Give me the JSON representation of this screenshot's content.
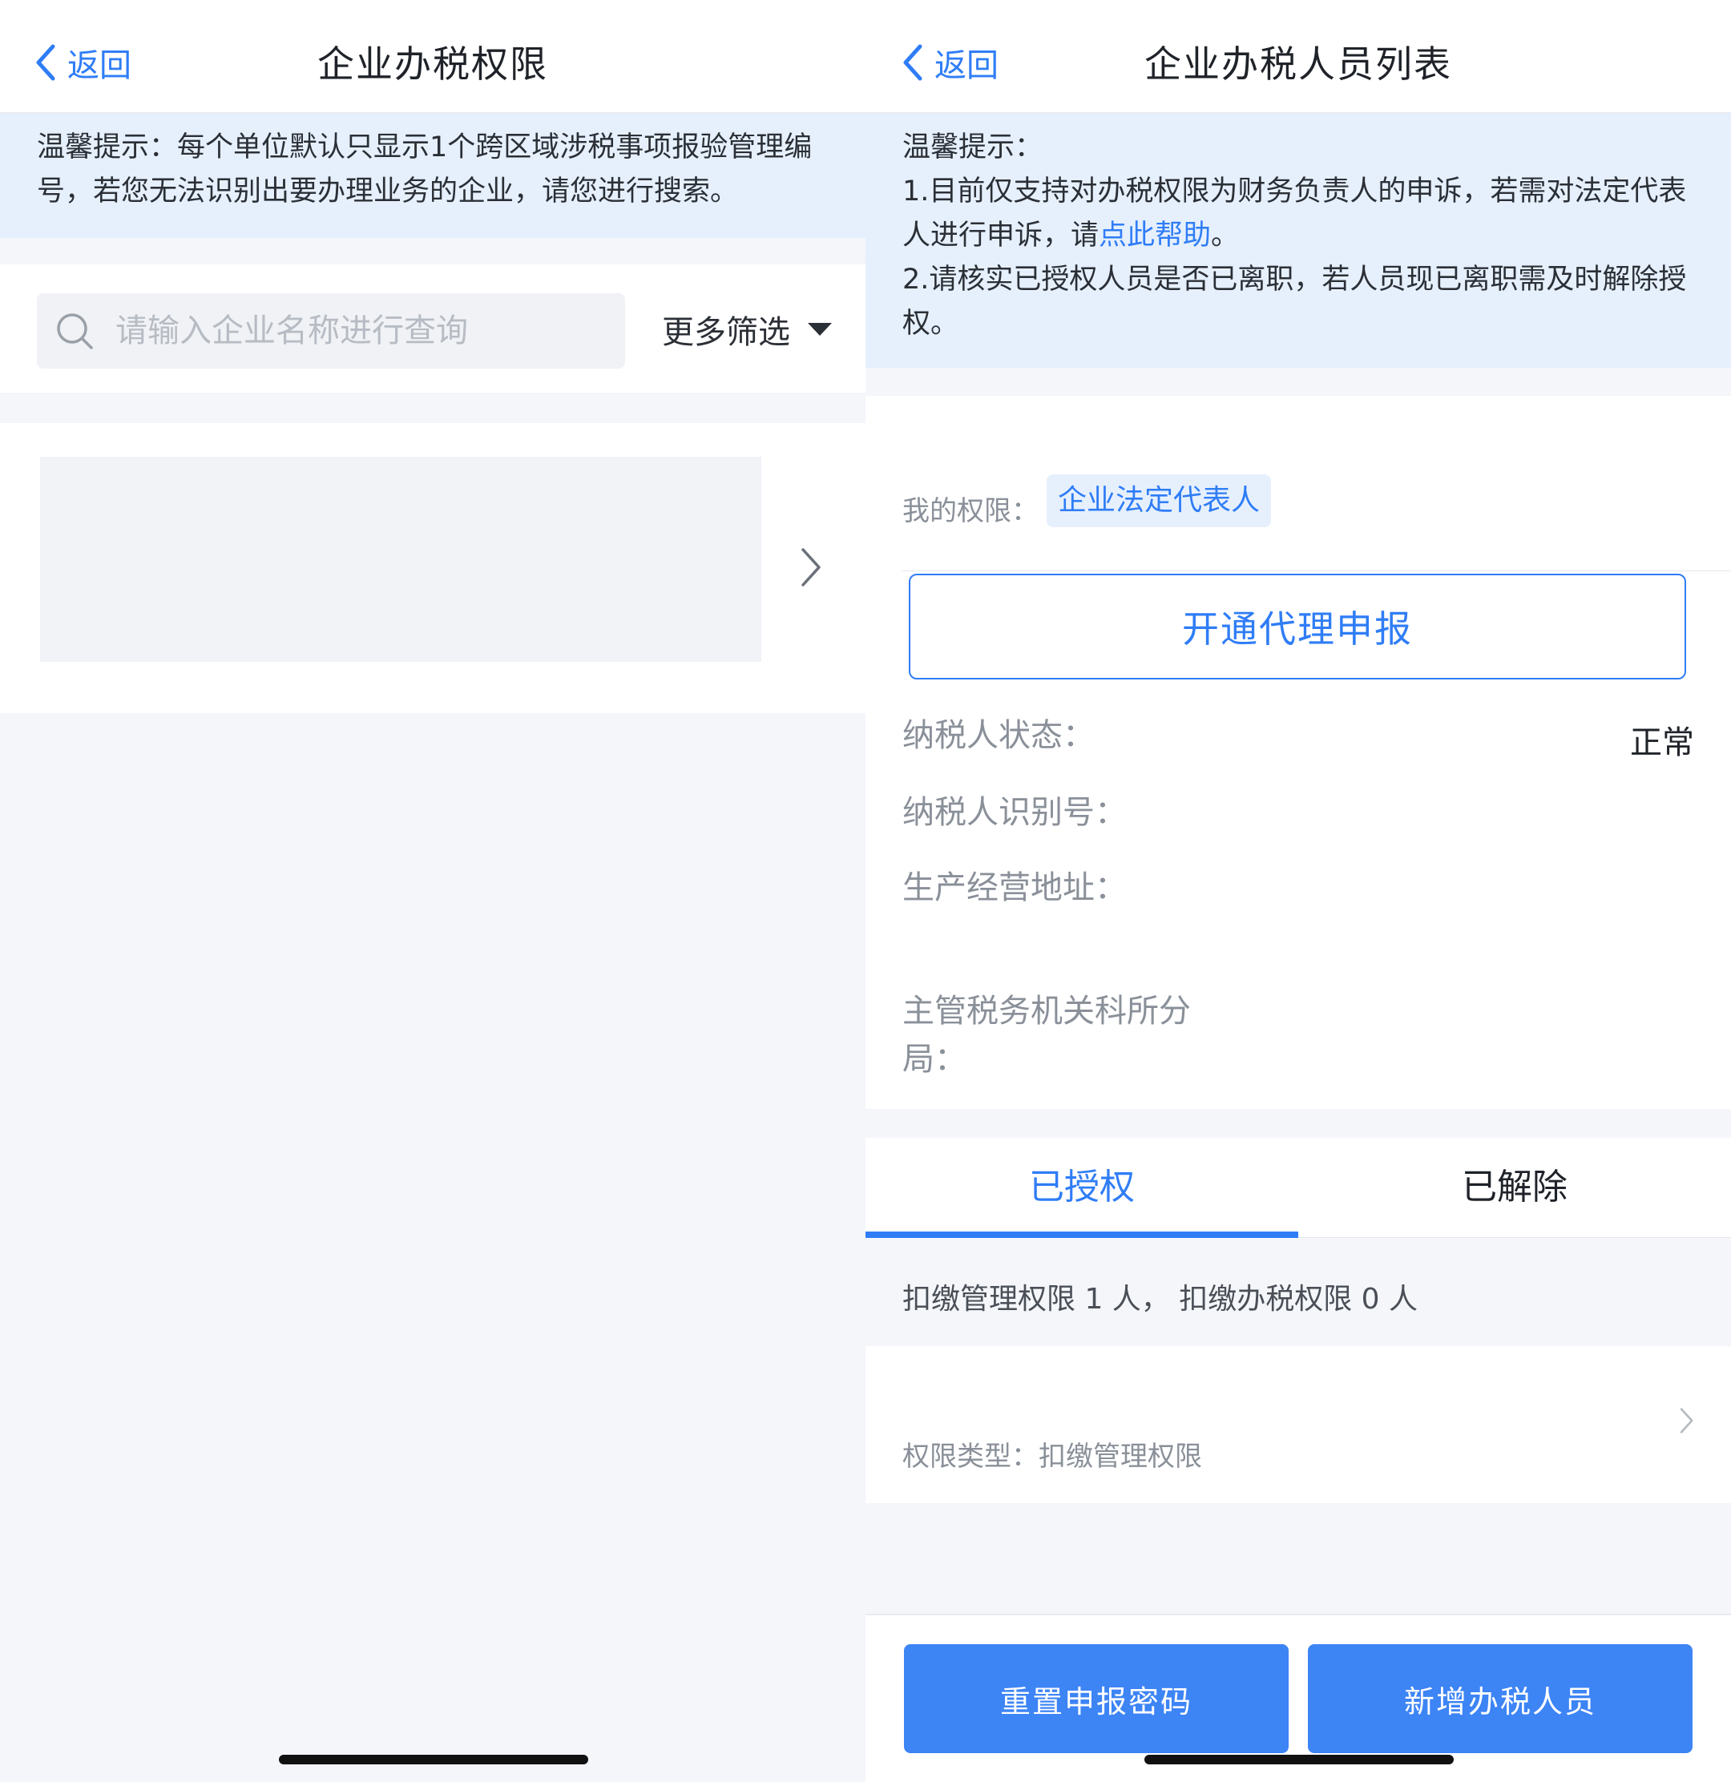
{
  "left": {
    "header": {
      "back_label": "返回",
      "title": "企业办税权限"
    },
    "tip": "温馨提示：每个单位默认只显示1个跨区域涉税事项报验管理编号，若您无法识别出要办理业务的企业，请您进行搜索。",
    "search": {
      "placeholder": "请输入企业名称进行查询",
      "filter_label": "更多筛选"
    }
  },
  "right": {
    "header": {
      "back_label": "返回",
      "title": "企业办税人员列表"
    },
    "tip": {
      "heading": "温馨提示：",
      "line1_prefix": "1.目前仅支持对办税权限为财务负责人的申诉，若需对法定代表人进行申诉，请",
      "line1_link": "点此帮助",
      "line1_suffix": "。",
      "line2": "2.请核实已授权人员是否已离职，若人员现已离职需及时解除授权。"
    },
    "info": {
      "permission_label": "我的权限：",
      "permission_tag": "企业法定代表人",
      "open_agent_button": "开通代理申报",
      "taxpayer_status_label": "纳税人状态：",
      "taxpayer_status_value": "正常",
      "taxpayer_id_label": "纳税人识别号：",
      "address_label": "生产经营地址：",
      "tax_office_label": "主管税务机关科所分局："
    },
    "tabs": [
      {
        "label": "已授权",
        "active": true
      },
      {
        "label": "已解除",
        "active": false
      }
    ],
    "count_text": "扣缴管理权限 1 人， 扣缴办税权限 0 人",
    "person": {
      "type_text": "权限类型：扣缴管理权限"
    },
    "buttons": {
      "reset": "重置申报密码",
      "add": "新增办税人员"
    }
  },
  "colors": {
    "accent": "#2f7df6",
    "tip_bg": "#e6f0fd",
    "page_bg": "#f4f6fa",
    "button_bg": "#3d84f5"
  }
}
